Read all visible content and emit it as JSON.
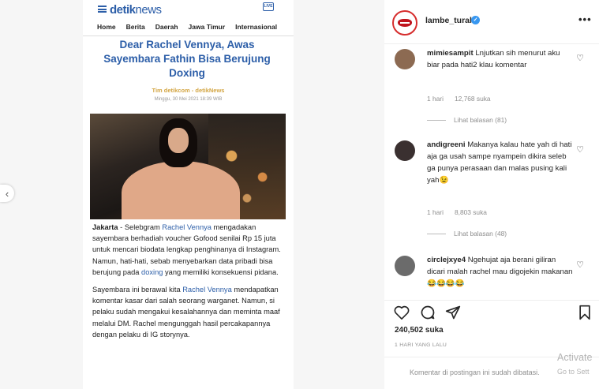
{
  "article": {
    "logo_main": "detik",
    "logo_sub": "news",
    "live_label": "LIVE",
    "menu": [
      "Home",
      "Berita",
      "Daerah",
      "Jawa Timur",
      "Internasional"
    ],
    "title": "Dear Rachel Vennya, Awas Sayembara Fathin Bisa Berujung Doxing",
    "author": "Tim detikcom - detikNews",
    "date": "Minggu, 30 Mei 2021 18:39 WIB",
    "p1_prefix": "Jakarta",
    "p1_a": " - Selebgram ",
    "p1_link1": "Rachel Vennya",
    "p1_b": " mengadakan sayembara berhadiah voucher Gofood senilai Rp 15 juta untuk mencari biodata lengkap penghinanya di Instagram. Namun, hati-hati, sebab menyebarkan data pribadi bisa berujung pada ",
    "p1_link2": "doxing",
    "p1_c": " yang memiliki konsekuensi pidana.",
    "p2_a": "Sayembara ini berawal kita ",
    "p2_link": "Rachel Vennya",
    "p2_b": " mendapatkan komentar kasar dari salah seorang warganet. Namun, si pelaku sudah mengakui kesalahannya dan meminta maaf melalui DM. Rachel mengunggah hasil percakapannya dengan pelaku di IG storynya."
  },
  "post": {
    "username": "lambe_turah",
    "verified_mark": "✓",
    "more": "•••",
    "likes": "240,502 suka",
    "time_ago": "1 HARI YANG LALU",
    "comments_closed": "Komentar di postingan ini sudah dibatasi."
  },
  "comments": [
    {
      "user": "mimiesampit",
      "text": "Lnjutkan sih menurut aku biar pada hati2 klau komentar",
      "time": "1 hari",
      "likes": "12,768 suka",
      "replies": "Lihat balasan (81)",
      "avatar_color": "#8c6a52"
    },
    {
      "user": "andigreeni",
      "text": "Makanya kalau hate yah di hati aja ga usah sampe nyampein dikira seleb ga punya perasaan dan malas pusing kali yah😉",
      "time": "1 hari",
      "likes": "8,803 suka",
      "replies": "Lihat balasan (48)",
      "avatar_color": "#3a3030"
    },
    {
      "user": "circlejxye4",
      "text": "Ngehujat aja berani giliran dicari malah rachel mau digojekin makanan😂😂😂😂",
      "avatar_color": "#6b6b6b"
    }
  ],
  "watermark": {
    "line1": "Activate",
    "line2": "Go to Sett"
  }
}
